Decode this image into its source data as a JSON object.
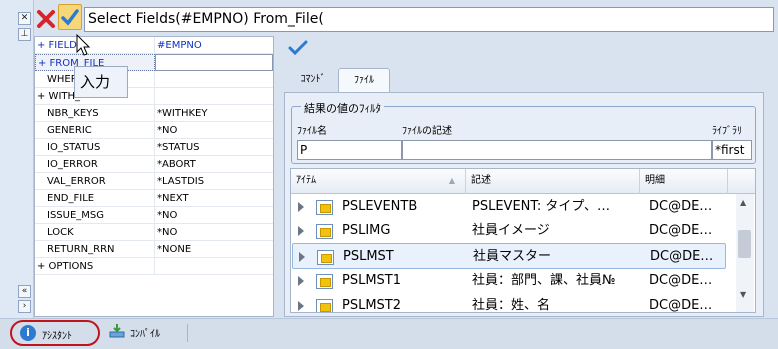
{
  "command_text": "Select Fields(#EMPNO) From_File(",
  "tooltip": "入力",
  "properties": [
    {
      "key": "+ FIELD",
      "value": "#EMPNO",
      "key_color": "#1030c0",
      "value_color": "#1030c0"
    },
    {
      "key": "+ FROM_FILE",
      "value": "",
      "key_color": "#1030c0",
      "value_color": "#000000"
    },
    {
      "key": "WHERE",
      "value": ""
    },
    {
      "key": "+ WITH_",
      "value": ""
    },
    {
      "key": "NBR_KEYS",
      "value": "*WITHKEY"
    },
    {
      "key": "GENERIC",
      "value": "*NO"
    },
    {
      "key": "IO_STATUS",
      "value": "*STATUS"
    },
    {
      "key": "IO_ERROR",
      "value": "*ABORT"
    },
    {
      "key": "VAL_ERROR",
      "value": "*LASTDIS"
    },
    {
      "key": "END_FILE",
      "value": "*NEXT"
    },
    {
      "key": "ISSUE_MSG",
      "value": "*NO"
    },
    {
      "key": "LOCK",
      "value": "*NO"
    },
    {
      "key": "RETURN_RRN",
      "value": "*NONE"
    },
    {
      "key": "+ OPTIONS",
      "value": ""
    }
  ],
  "tabs": {
    "command": "ｺﾏﾝﾄﾞ",
    "file": "ﾌｧｲﾙ"
  },
  "filter": {
    "title": "結果の値のﾌｨﾙﾀ",
    "file_name_label": "ﾌｧｲﾙ名",
    "file_desc_label": "ﾌｧｲﾙの記述",
    "library_label": "ﾗｲﾌﾞﾗﾘ",
    "file_name_value": "P",
    "file_desc_value": "",
    "library_value": "*first"
  },
  "list": {
    "columns": [
      "ｱｲﾃﾑ",
      "記述",
      "明細"
    ],
    "rows": [
      {
        "item": "PSLEVENTB",
        "desc": "PSLEVENT: タイプ、…",
        "detail": "DC@DE…"
      },
      {
        "item": "PSLIMG",
        "desc": "社員イメージ",
        "detail": "DC@DE…"
      },
      {
        "item": "PSLMST",
        "desc": "社員マスター",
        "detail": "DC@DE…"
      },
      {
        "item": "PSLMST1",
        "desc": "社員：部門、課、社員№",
        "detail": "DC@DE…"
      },
      {
        "item": "PSLMST2",
        "desc": "社員：姓、名",
        "detail": "DC@DE…"
      }
    ]
  },
  "bottom": {
    "assistant": "ｱｼｽﾀﾝﾄ",
    "compile": "ｺﾝﾊﾟｲﾙ"
  },
  "colors": {
    "accent": "#2e7ad1",
    "cancel": "#d8232a",
    "highlight": "#c0141c"
  }
}
